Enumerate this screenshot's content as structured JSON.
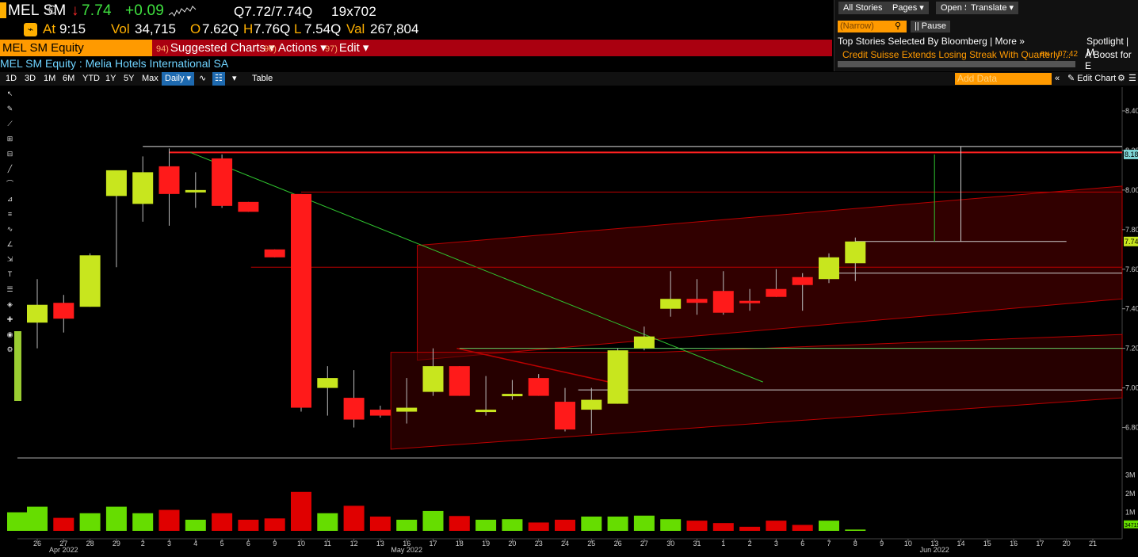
{
  "header": {
    "ticker": "MEL SM",
    "currency": "€",
    "last_arrow": "↓",
    "last": "7.74",
    "change": "+0.09",
    "bidask": "Q7.72/7.74Q",
    "size": "19x702",
    "at_label": "At",
    "time": "9:15",
    "vol_label": "Vol",
    "vol": "34,715",
    "open_label": "O",
    "open": "7.62Q",
    "high_label": "H",
    "high": "7.76Q",
    "low_label": "L",
    "low": "7.54Q",
    "val_label": "Val",
    "val": "267,804"
  },
  "security_bar": {
    "ticker": "MEL SM Equity",
    "menus": [
      {
        "num": "94)",
        "label": "Suggested Charts ▾"
      },
      {
        "num": "96)",
        "label": "Actions ▾"
      },
      {
        "num": "97)",
        "label": "Edit ▾"
      }
    ]
  },
  "description": "MEL SM Equity : Melia Hotels International SA",
  "news": {
    "buttons": [
      "All Stories",
      "Pages ▾",
      "Open Search",
      "Translate ▾"
    ],
    "narrow_placeholder": "(Narrow)",
    "pause": "|| Pause",
    "top_stories": "Top Stories Selected By Bloomberg | More »",
    "headline": "Credit Suisse Extends Losing Streak With Quarterly ...",
    "source": "BN",
    "time": "07:42",
    "spotlight": "Spotlight | M",
    "spotlight_headline": "A Boost for E"
  },
  "toolbar": {
    "periods": [
      "1D",
      "3D",
      "1M",
      "6M",
      "YTD",
      "1Y",
      "5Y",
      "Max"
    ],
    "frequency": "Daily ▾",
    "table": "Table",
    "add_data": "Add Data",
    "edit_chart": "Edit Chart"
  },
  "colors": {
    "up": "#c8e61e",
    "down": "#ff1a1a",
    "vol_up": "#66dd00",
    "vol_down": "#e00000",
    "accent": "#ff9a00",
    "header_bar": "#aa0010"
  },
  "chart_data": {
    "type": "candlestick",
    "y_ticks": [
      "8.40",
      "8.20",
      "8.00",
      "7.80",
      "7.60",
      "7.40",
      "7.20",
      "7.00",
      "6.80"
    ],
    "ylim": [
      6.65,
      8.52
    ],
    "last_price_label": "7.74",
    "top_price_label": "8.18",
    "vol_ticks": [
      "3M",
      "2M",
      "1M"
    ],
    "vol_last_label": "34715",
    "x_day_labels": [
      "26",
      "27",
      "28",
      "29",
      "2",
      "3",
      "4",
      "5",
      "6",
      "9",
      "10",
      "11",
      "12",
      "13",
      "16",
      "17",
      "18",
      "19",
      "20",
      "23",
      "24",
      "25",
      "26",
      "27",
      "30",
      "31",
      "1",
      "2",
      "3",
      "6",
      "7",
      "8",
      "9",
      "10",
      "13",
      "14",
      "15",
      "16",
      "17",
      "20",
      "21"
    ],
    "month_labels": [
      {
        "label": "Apr 2022",
        "index": 1
      },
      {
        "label": "May 2022",
        "index": 14
      },
      {
        "label": "Jun 2022",
        "index": 34
      }
    ],
    "candles": [
      {
        "o": 7.33,
        "h": 7.55,
        "l": 7.2,
        "c": 7.42
      },
      {
        "o": 7.43,
        "h": 7.47,
        "l": 7.28,
        "c": 7.35
      },
      {
        "o": 7.41,
        "h": 7.68,
        "l": 7.41,
        "c": 7.67
      },
      {
        "o": 7.97,
        "h": 8.02,
        "l": 7.61,
        "c": 8.1
      },
      {
        "o": 7.93,
        "h": 8.17,
        "l": 7.84,
        "c": 8.09
      },
      {
        "o": 8.12,
        "h": 8.21,
        "l": 7.82,
        "c": 7.98
      },
      {
        "o": 7.99,
        "h": 8.09,
        "l": 7.91,
        "c": 8.0
      },
      {
        "o": 8.16,
        "h": 8.18,
        "l": 7.91,
        "c": 7.92
      },
      {
        "o": 7.94,
        "h": 7.94,
        "l": 7.89,
        "c": 7.89
      },
      {
        "o": 7.7,
        "h": 7.7,
        "l": 7.66,
        "c": 7.66
      },
      {
        "o": 7.98,
        "h": 7.98,
        "l": 6.88,
        "c": 6.9
      },
      {
        "o": 7.0,
        "h": 7.11,
        "l": 6.86,
        "c": 7.05
      },
      {
        "o": 6.95,
        "h": 7.09,
        "l": 6.8,
        "c": 6.84
      },
      {
        "o": 6.89,
        "h": 6.91,
        "l": 6.85,
        "c": 6.86
      },
      {
        "o": 6.88,
        "h": 7.05,
        "l": 6.82,
        "c": 6.9
      },
      {
        "o": 6.98,
        "h": 7.2,
        "l": 6.96,
        "c": 7.11
      },
      {
        "o": 7.11,
        "h": 7.11,
        "l": 6.96,
        "c": 6.96
      },
      {
        "o": 6.89,
        "h": 7.06,
        "l": 6.86,
        "c": 6.89
      },
      {
        "o": 6.97,
        "h": 7.04,
        "l": 6.94,
        "c": 6.97
      },
      {
        "o": 7.05,
        "h": 7.07,
        "l": 6.96,
        "c": 6.96
      },
      {
        "o": 6.93,
        "h": 7.0,
        "l": 6.78,
        "c": 6.79
      },
      {
        "o": 6.89,
        "h": 7.0,
        "l": 6.77,
        "c": 6.94
      },
      {
        "o": 6.92,
        "h": 7.2,
        "l": 6.92,
        "c": 7.19
      },
      {
        "o": 7.2,
        "h": 7.31,
        "l": 7.19,
        "c": 7.26
      },
      {
        "o": 7.4,
        "h": 7.59,
        "l": 7.36,
        "c": 7.45
      },
      {
        "o": 7.45,
        "h": 7.55,
        "l": 7.37,
        "c": 7.43
      },
      {
        "o": 7.49,
        "h": 7.59,
        "l": 7.37,
        "c": 7.38
      },
      {
        "o": 7.44,
        "h": 7.5,
        "l": 7.39,
        "c": 7.43
      },
      {
        "o": 7.5,
        "h": 7.6,
        "l": 7.46,
        "c": 7.46
      },
      {
        "o": 7.56,
        "h": 7.58,
        "l": 7.39,
        "c": 7.52
      },
      {
        "o": 7.55,
        "h": 7.68,
        "l": 7.53,
        "c": 7.66
      },
      {
        "o": 7.63,
        "h": 7.76,
        "l": 7.54,
        "c": 7.74
      }
    ],
    "volume": [
      1.0,
      1.3,
      0.7,
      0.95,
      1.3,
      0.95,
      1.13,
      0.6,
      0.95,
      0.6,
      0.67,
      2.1,
      0.95,
      1.35,
      0.77,
      0.6,
      1.07,
      0.8,
      0.6,
      0.63,
      0.45,
      0.6,
      0.77,
      0.77,
      0.82,
      0.63,
      0.55,
      0.42,
      0.22,
      0.55,
      0.32,
      0.55,
      0.07
    ],
    "vol_max_m": 3.5
  }
}
